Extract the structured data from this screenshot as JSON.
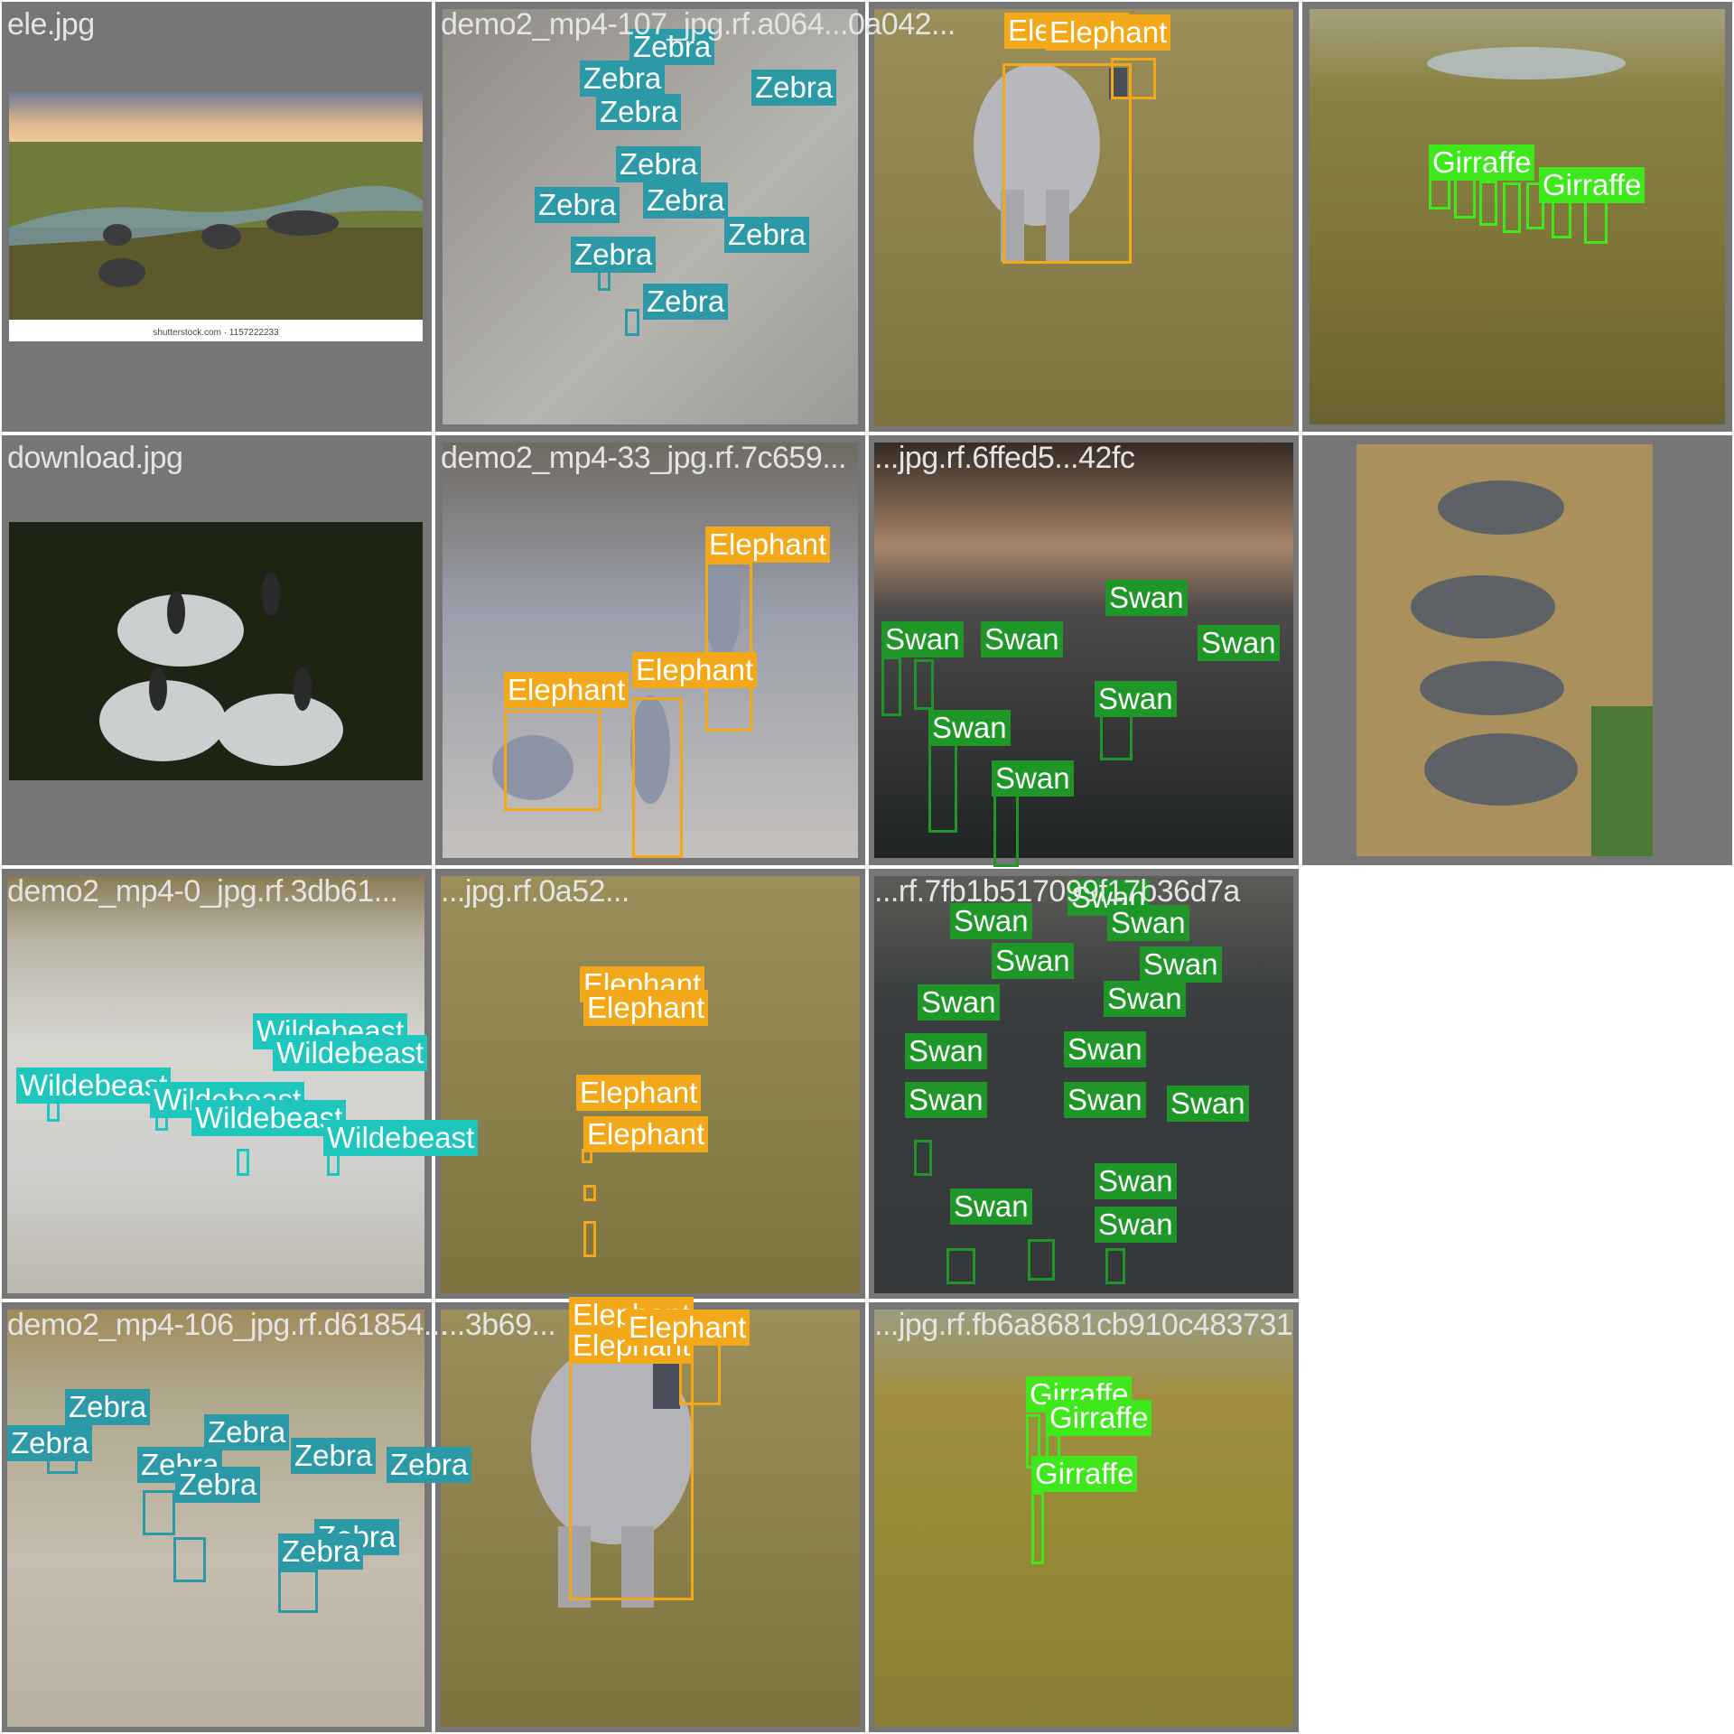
{
  "colors": {
    "Elephant": "#f2a818",
    "Zebra": "#2b9aa6",
    "Giraffe": "#3ee81a",
    "Swan": "#1e9628",
    "Wildebeast": "#1ec6be",
    "tile_bg": "#767676",
    "filename": "#e4e4e4"
  },
  "tiles": [
    {
      "filename": "ele.jpg",
      "caption": "shutterstock.com · 1157222233"
    },
    {
      "filename": "demo2_mp4-107_jpg.rf.a064...0a042..."
    },
    {
      "filename": ""
    },
    {
      "filename": ""
    },
    {
      "filename": "download.jpg"
    },
    {
      "filename": "demo2_mp4-33_jpg.rf.7c659..."
    },
    {
      "filename": "...jpg.rf.6ffed5...42fc"
    },
    {
      "filename": ""
    },
    {
      "filename": "demo2_mp4-0_jpg.rf.3db61..."
    },
    {
      "filename": "...jpg.rf.0a52..."
    },
    {
      "filename": "...rf.7fb1b517099f17b36d7a"
    },
    {
      "filename": ""
    },
    {
      "filename": "demo2_mp4-106_jpg.rf.d61854..."
    },
    {
      "filename": "...3b69..."
    },
    {
      "filename": "...jpg.rf.fb6a8681cb910c483731"
    },
    {
      "filename": ""
    }
  ],
  "labels": {
    "elephant": "Elephant",
    "zebra": "Zebra",
    "giraffe": "Girraffe",
    "swan": "Swan",
    "wildebeast": "Wildebeast"
  }
}
